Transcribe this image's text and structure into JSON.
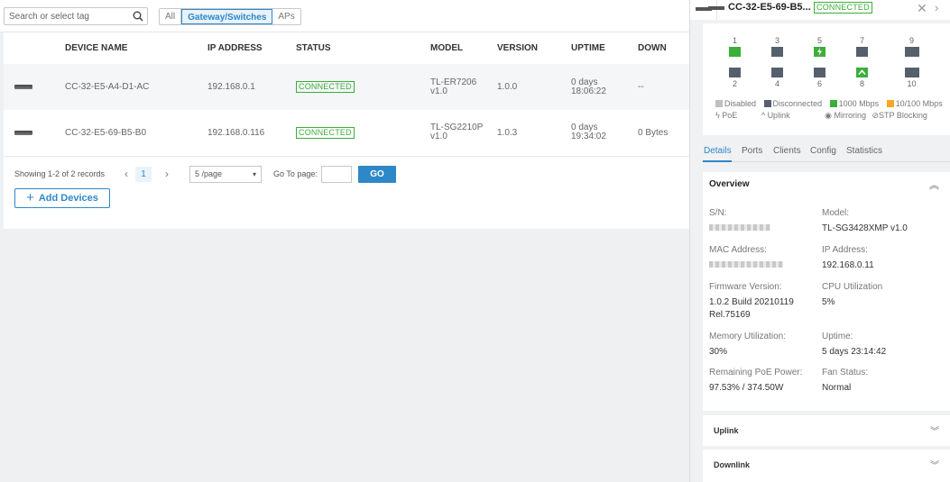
{
  "toolbar": {
    "search_placeholder": "Search or select tag",
    "filters": [
      "All",
      "Gateway/Switches",
      "APs"
    ],
    "active_filter": "Gateway/Switches"
  },
  "table": {
    "headers": [
      "DEVICE NAME",
      "IP ADDRESS",
      "STATUS",
      "MODEL",
      "VERSION",
      "UPTIME",
      "DOWN"
    ],
    "rows": [
      {
        "name": "CC-32-E5-A4-D1-AC",
        "ip": "192.168.0.1",
        "status": "CONNECTED",
        "model_1": "TL-ER7206",
        "model_2": "v1.0",
        "version": "1.0.0",
        "uptime_1": "0 days",
        "uptime_2": "18:06:22",
        "down": "--"
      },
      {
        "name": "CC-32-E5-69-B5-B0",
        "ip": "192.168.0.116",
        "status": "CONNECTED",
        "model_1": "TL-SG2210P",
        "model_2": "v1.0",
        "version": "1.0.3",
        "uptime_1": "0 days",
        "uptime_2": "19:34:02",
        "down": "0 Bytes"
      }
    ]
  },
  "pager": {
    "records": "Showing 1-2 of 2 records",
    "prev": "‹",
    "next": "›",
    "current_page": "1",
    "page_size": "5 /page",
    "goto_label": "Go To page:",
    "go_label": "GO"
  },
  "add_devices": {
    "label": "Add Devices"
  },
  "detail": {
    "title": "CC-32-E5-69-B5...",
    "status": "CONNECTED",
    "ports_top": [
      "1",
      "3",
      "5",
      "7",
      "9"
    ],
    "ports_bottom": [
      "2",
      "4",
      "6",
      "8",
      "10"
    ],
    "legend": {
      "disabled": "Disabled",
      "disconnected": "Disconnected",
      "speed_1000": "1000 Mbps",
      "speed_10_100": "10/100 Mbps",
      "poe": "PoE",
      "uplink": "Uplink",
      "mirroring": "Mirroring",
      "stp": "STP Blocking"
    },
    "tabs": [
      "Details",
      "Ports",
      "Clients",
      "Config",
      "Statistics"
    ],
    "active_tab": "Details",
    "overview": {
      "title": "Overview",
      "sn_label": "S/N:",
      "model_label": "Model:",
      "model": "TL-SG3428XMP v1.0",
      "mac_label": "MAC Address:",
      "ip_label": "IP Address:",
      "ip": "192.168.0.11",
      "fw_label": "Firmware Version:",
      "fw_1": "1.0.2 Build 20210119",
      "fw_2": "Rel.75169",
      "cpu_label": "CPU Utilization",
      "cpu": "5%",
      "mem_label": "Memory Utilization:",
      "mem": "30%",
      "uptime_label": "Uptime:",
      "uptime": "5 days 23:14:42",
      "poe_label": "Remaining PoE Power:",
      "poe": "97.53% / 374.50W",
      "fan_label": "Fan Status:",
      "fan": "Normal"
    },
    "uplink_title": "Uplink",
    "downlink_title": "Downlink"
  },
  "colors": {
    "accent": "#2d88c8",
    "connected": "#3cae3a",
    "disconnected": "#56606d",
    "disabled": "#bfbfbf",
    "speed_10_100": "#f5a623"
  }
}
